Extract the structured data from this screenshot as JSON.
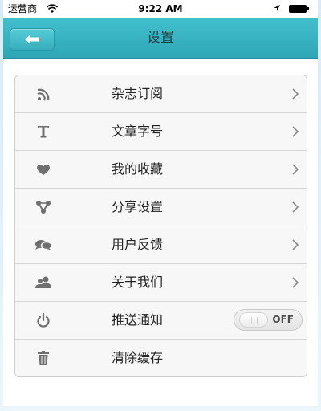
{
  "status_bar": {
    "carrier": "运营商",
    "time": "9:22 AM"
  },
  "nav": {
    "title": "设置",
    "back_icon": "back-arrow-icon"
  },
  "colors": {
    "nav_top": "#42c0cd",
    "nav_bottom": "#2ea6b5",
    "icon_gray": "#6f6f6f"
  },
  "settings": {
    "items": [
      {
        "label": "杂志订阅",
        "icon": "rss-icon",
        "chevron": true
      },
      {
        "label": "文章字号",
        "icon": "font-size-icon",
        "chevron": true
      },
      {
        "label": "我的收藏",
        "icon": "heart-icon",
        "chevron": true
      },
      {
        "label": "分享设置",
        "icon": "share-icon",
        "chevron": true
      },
      {
        "label": "用户反馈",
        "icon": "chat-bubbles-icon",
        "chevron": true
      },
      {
        "label": "关于我们",
        "icon": "users-icon",
        "chevron": true
      },
      {
        "label": "推送通知",
        "icon": "power-icon",
        "toggle": {
          "state": "OFF"
        }
      },
      {
        "label": "清除缓存",
        "icon": "trash-icon"
      }
    ]
  }
}
